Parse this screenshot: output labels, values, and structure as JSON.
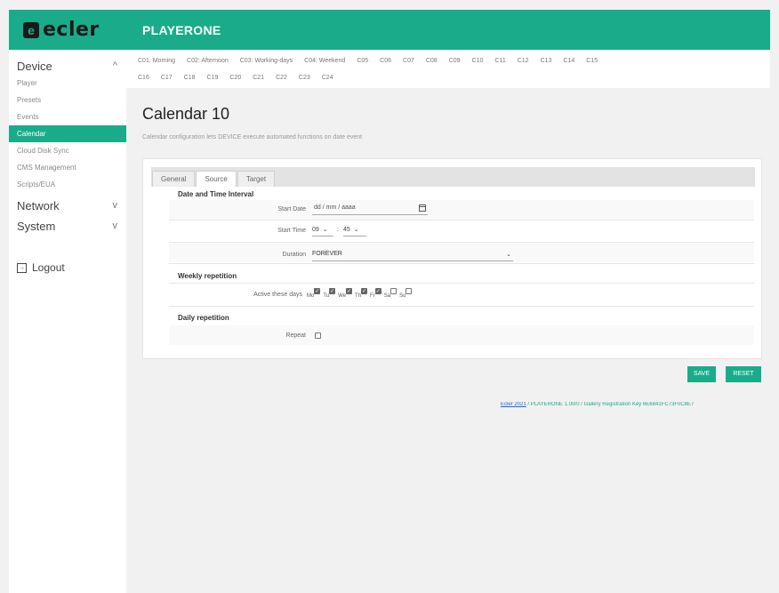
{
  "header": {
    "logo_mark": "e",
    "logo_text": "ecler",
    "app_title": "PLAYERONE"
  },
  "sidebar": {
    "device": {
      "label": "Device",
      "chevron": "^",
      "items": [
        "Player",
        "Presets",
        "Events",
        "Calendar",
        "Cloud Disk Sync",
        "CMS Management",
        "Scripts/EUA"
      ]
    },
    "network": {
      "label": "Network",
      "chevron": "v"
    },
    "system": {
      "label": "System",
      "chevron": "v"
    },
    "logout": {
      "label": "Logout",
      "icon": "logout-icon"
    }
  },
  "calendar_tabs": {
    "row1": [
      "C01: Morning",
      "C02: Afternoon",
      "C03: Working-days",
      "C04: Weekend",
      "C05",
      "C06",
      "C07",
      "C08",
      "C09",
      "C10",
      "C11",
      "C12",
      "C13",
      "C14",
      "C15"
    ],
    "row2": [
      "C16",
      "C17",
      "C18",
      "C19",
      "C20",
      "C21",
      "C22",
      "C23",
      "C24"
    ]
  },
  "main": {
    "title": "Calendar 10",
    "description": "Calendar configuration lets DEVICE execute automated functions on date event",
    "form_tabs": [
      "General",
      "Source",
      "Target"
    ],
    "sections": {
      "date_time": "Date and Time Interval",
      "weekly": "Weekly repetition",
      "daily": "Daily repetition"
    },
    "fields": {
      "start_date_label": "Start Date",
      "start_date_value": "dd / mm / aaaa",
      "start_time_label": "Start Time",
      "start_hour": "09",
      "start_minute": "45",
      "time_separator": ":",
      "duration_label": "Duration",
      "duration_value": "FOREVER",
      "active_days_label": "Active these days",
      "repeat_label": "Repeat"
    },
    "days": [
      {
        "label": "Mo",
        "checked": true
      },
      {
        "label": "Tu",
        "checked": true
      },
      {
        "label": "We",
        "checked": true
      },
      {
        "label": "Th",
        "checked": true
      },
      {
        "label": "Fr",
        "checked": true
      },
      {
        "label": "Sa",
        "checked": false
      },
      {
        "label": "Su",
        "checked": false
      }
    ],
    "repeat_checked": false,
    "buttons": {
      "save": "SAVE",
      "reset": "RESET"
    }
  },
  "footer": {
    "link": "Ecler 2021",
    "text": " / PLAYERONE 1.00r0 / Gallery Registration Key 6E6841FC73F0C8E7"
  },
  "colors": {
    "accent": "#1aac8a",
    "background": "#f1f1f1"
  }
}
